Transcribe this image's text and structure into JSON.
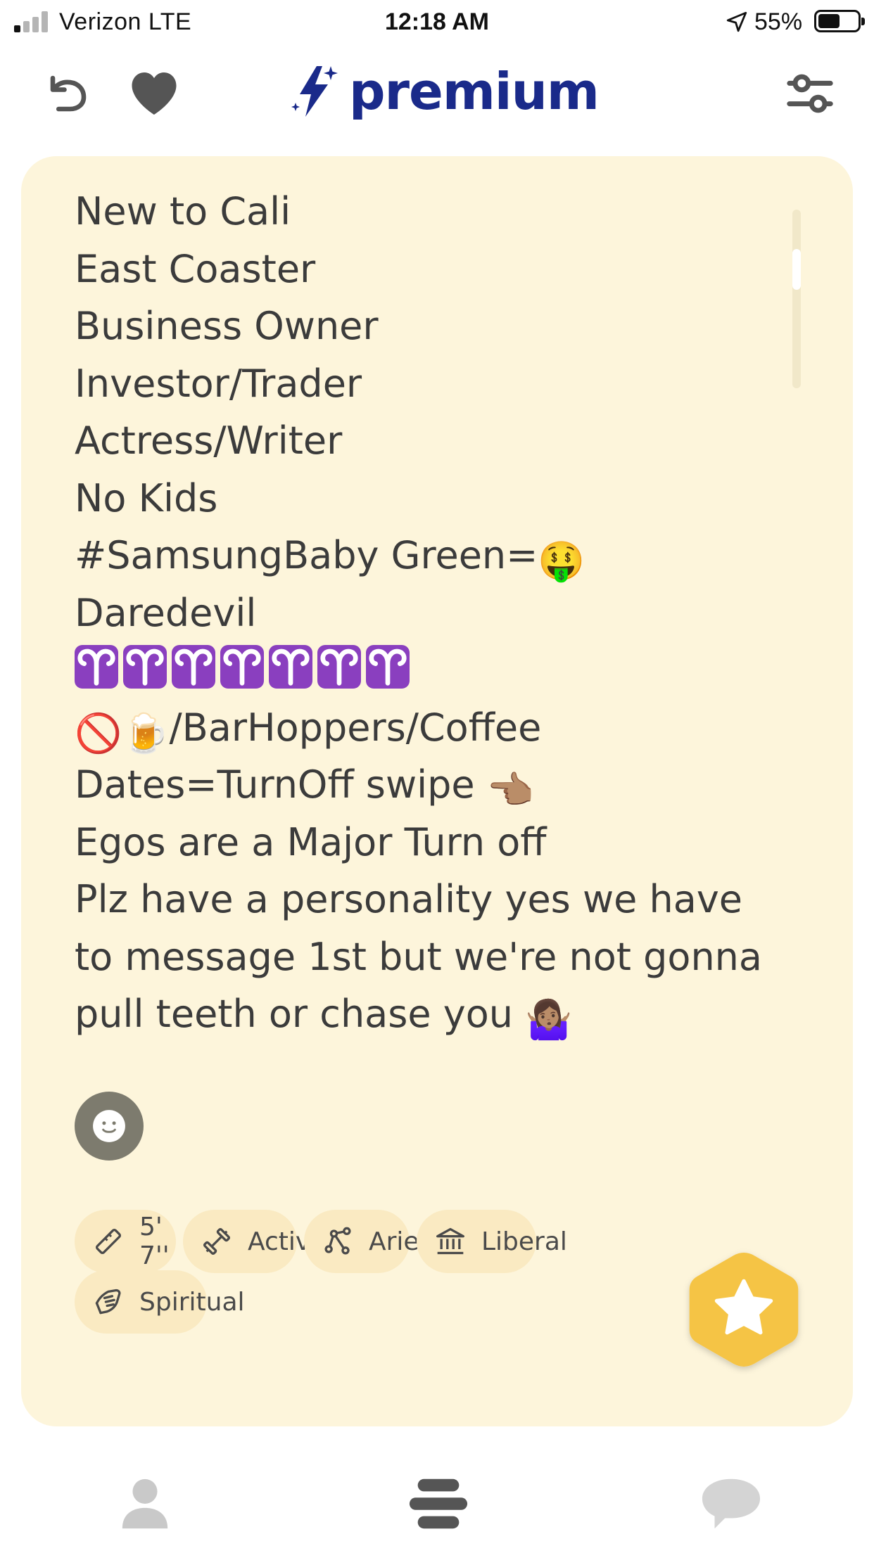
{
  "status_bar": {
    "carrier": "Verizon  LTE",
    "time": "12:18 AM",
    "battery_percent": "55%",
    "battery_level": 0.55,
    "signal_bars_active": 1,
    "signal_bars_total": 4
  },
  "topnav": {
    "brand_label": "premium",
    "brand_color": "#1a2a8a",
    "undo_icon": "undo-arrow-icon",
    "like_icon": "heart-icon",
    "filter_icon": "sliders-filter-icon"
  },
  "card": {
    "background": "#fdf5db",
    "bio_lines": [
      "New to Cali",
      "East Coaster",
      "Business Owner",
      "Investor/Trader",
      "Actress/Writer",
      "No Kids",
      "#SamsungBaby Green=",
      "Daredevil",
      "",
      "/BarHoppers/Coffee",
      "Dates=TurnOff swipe ",
      "Egos are a Major Turn off",
      "Plz have a personality yes we have",
      "to message 1st but we're not gonna",
      "pull teeth or chase you "
    ],
    "emoji": {
      "money_mouth": "🤑",
      "aries_sign": "♈",
      "aries_count": 7,
      "prohibited": "🚫",
      "beer": "🍺",
      "pointing_left": "👈🏽",
      "shrug": "🤷🏽‍♀️"
    },
    "chips": [
      {
        "label": "5' 7''",
        "icon": "ruler-icon"
      },
      {
        "label": "Active",
        "icon": "dumbbell-icon"
      },
      {
        "label": "Aries",
        "icon": "constellation-icon"
      },
      {
        "label": "Liberal",
        "icon": "government-building-icon"
      },
      {
        "label": "Spiritual",
        "icon": "praying-hands-icon"
      }
    ],
    "superlike_color": "#f5c444",
    "chip_color": "#faeac2"
  },
  "tabbar": {
    "items": [
      {
        "icon": "profile-person-icon"
      },
      {
        "icon": "discover-stack-icon"
      },
      {
        "icon": "chat-bubble-icon"
      }
    ]
  }
}
